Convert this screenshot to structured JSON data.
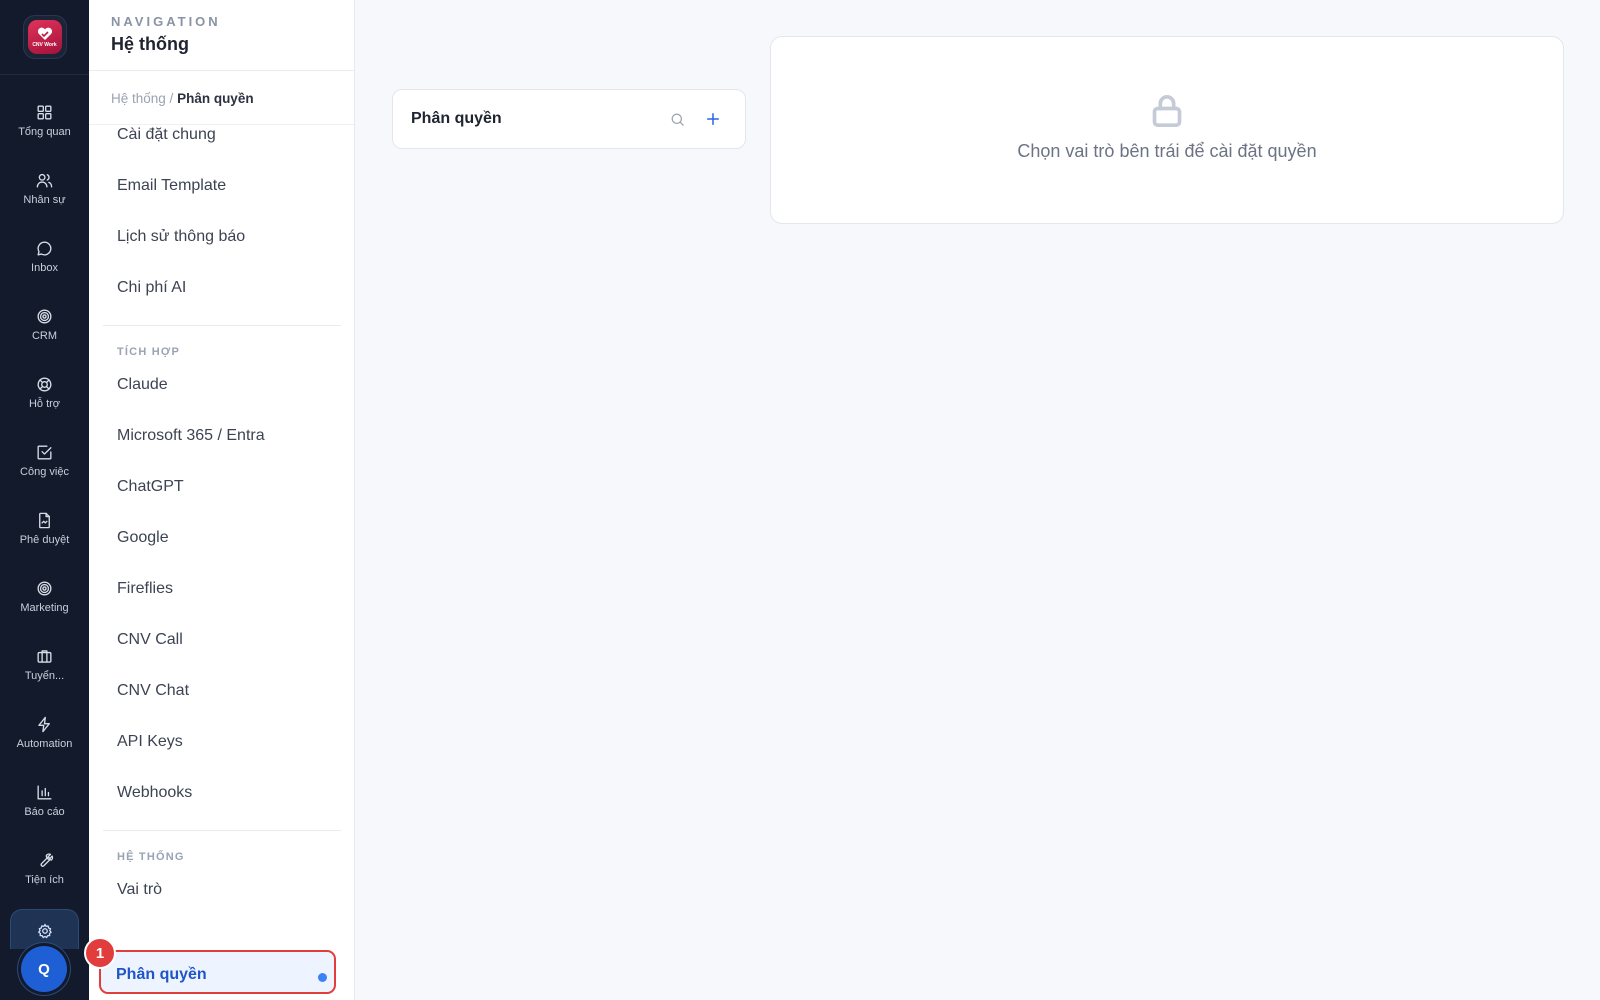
{
  "rail": {
    "logo_text": "CNV Work",
    "items": [
      {
        "label": "Tổng quan",
        "icon": "grid-icon"
      },
      {
        "label": "Nhân sự",
        "icon": "users-icon"
      },
      {
        "label": "Inbox",
        "icon": "message-icon"
      },
      {
        "label": "CRM",
        "icon": "target-icon"
      },
      {
        "label": "Hỗ trợ",
        "icon": "lifebuoy-icon"
      },
      {
        "label": "Công việc",
        "icon": "checkbox-icon"
      },
      {
        "label": "Phê duyệt",
        "icon": "file-sign-icon"
      },
      {
        "label": "Marketing",
        "icon": "target-icon"
      },
      {
        "label": "Tuyển...",
        "icon": "briefcase-icon"
      },
      {
        "label": "Automation",
        "icon": "bolt-icon"
      },
      {
        "label": "Báo cáo",
        "icon": "bar-chart-icon"
      },
      {
        "label": "Tiện ích",
        "icon": "wrench-icon"
      }
    ],
    "active_icon": "gear-icon",
    "avatar_initial": "Q"
  },
  "nav": {
    "kicker": "NAVIGATION",
    "title": "Hệ thống",
    "breadcrumb": {
      "parent": "Hệ thống",
      "separator": " / ",
      "current": "Phân quyền"
    },
    "top_items": [
      "Cài đặt chung",
      "Email Template",
      "Lịch sử thông báo",
      "Chi phí AI"
    ],
    "group_integration": {
      "label": "TÍCH HỢP",
      "items": [
        "Claude",
        "Microsoft 365 / Entra",
        "ChatGPT",
        "Google",
        "Fireflies",
        "CNV Call",
        "CNV Chat",
        "API Keys",
        "Webhooks"
      ]
    },
    "group_system": {
      "label": "HỆ THỐNG",
      "items": [
        "Vai trò"
      ]
    },
    "active_item": "Phân quyền",
    "step_badge": "1"
  },
  "roles_panel": {
    "title": "Phân quyền"
  },
  "empty_state": {
    "message": "Chọn vai trò bên trái để cài đặt quyền"
  },
  "colors": {
    "accent": "#2d63e0",
    "highlight": "#e23d3d",
    "rail_bg": "#121a2b"
  }
}
